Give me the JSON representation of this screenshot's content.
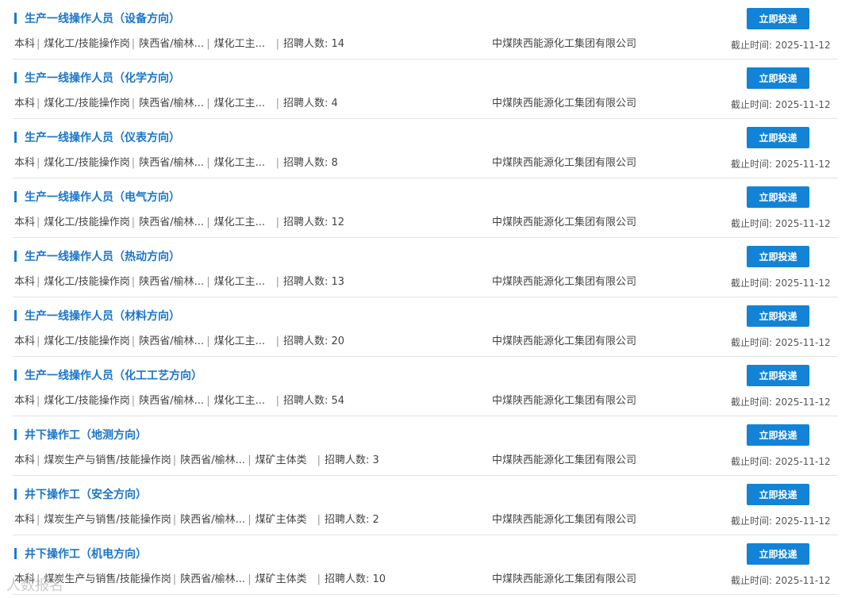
{
  "apply_label": "立即投递",
  "deadline_label": "截止时间: ",
  "sep": "|",
  "count_label": "招聘人数: ",
  "jobs": [
    {
      "title": "生产一线操作人员（设备方向）",
      "degree": "本科",
      "category": "煤化工/技能操作岗",
      "location": "陕西省/榆林...",
      "industry": "煤化工主...",
      "count": "14",
      "company": "中煤陕西能源化工集团有限公司",
      "deadline": "2025-11-12"
    },
    {
      "title": "生产一线操作人员（化学方向）",
      "degree": "本科",
      "category": "煤化工/技能操作岗",
      "location": "陕西省/榆林...",
      "industry": "煤化工主...",
      "count": "4",
      "company": "中煤陕西能源化工集团有限公司",
      "deadline": "2025-11-12"
    },
    {
      "title": "生产一线操作人员（仪表方向）",
      "degree": "本科",
      "category": "煤化工/技能操作岗",
      "location": "陕西省/榆林...",
      "industry": "煤化工主...",
      "count": "8",
      "company": "中煤陕西能源化工集团有限公司",
      "deadline": "2025-11-12"
    },
    {
      "title": "生产一线操作人员（电气方向）",
      "degree": "本科",
      "category": "煤化工/技能操作岗",
      "location": "陕西省/榆林...",
      "industry": "煤化工主...",
      "count": "12",
      "company": "中煤陕西能源化工集团有限公司",
      "deadline": "2025-11-12"
    },
    {
      "title": "生产一线操作人员（热动方向）",
      "degree": "本科",
      "category": "煤化工/技能操作岗",
      "location": "陕西省/榆林...",
      "industry": "煤化工主...",
      "count": "13",
      "company": "中煤陕西能源化工集团有限公司",
      "deadline": "2025-11-12"
    },
    {
      "title": "生产一线操作人员（材料方向）",
      "degree": "本科",
      "category": "煤化工/技能操作岗",
      "location": "陕西省/榆林...",
      "industry": "煤化工主...",
      "count": "20",
      "company": "中煤陕西能源化工集团有限公司",
      "deadline": "2025-11-12"
    },
    {
      "title": "生产一线操作人员（化工工艺方向）",
      "degree": "本科",
      "category": "煤化工/技能操作岗",
      "location": "陕西省/榆林...",
      "industry": "煤化工主...",
      "count": "54",
      "company": "中煤陕西能源化工集团有限公司",
      "deadline": "2025-11-12"
    },
    {
      "title": "井下操作工（地测方向）",
      "degree": "本科",
      "category": "煤炭生产与销售/技能操作岗",
      "location": "陕西省/榆林...",
      "industry": "煤矿主体类",
      "count": "3",
      "company": "中煤陕西能源化工集团有限公司",
      "deadline": "2025-11-12"
    },
    {
      "title": "井下操作工（安全方向）",
      "degree": "本科",
      "category": "煤炭生产与销售/技能操作岗",
      "location": "陕西省/榆林...",
      "industry": "煤矿主体类",
      "count": "2",
      "company": "中煤陕西能源化工集团有限公司",
      "deadline": "2025-11-12"
    },
    {
      "title": "井下操作工（机电方向）",
      "degree": "本科",
      "category": "煤炭生产与销售/技能操作岗",
      "location": "陕西省/榆林...",
      "industry": "煤矿主体类",
      "count": "10",
      "company": "中煤陕西能源化工集团有限公司",
      "deadline": "2025-11-12"
    }
  ],
  "watermark": "人数报名"
}
